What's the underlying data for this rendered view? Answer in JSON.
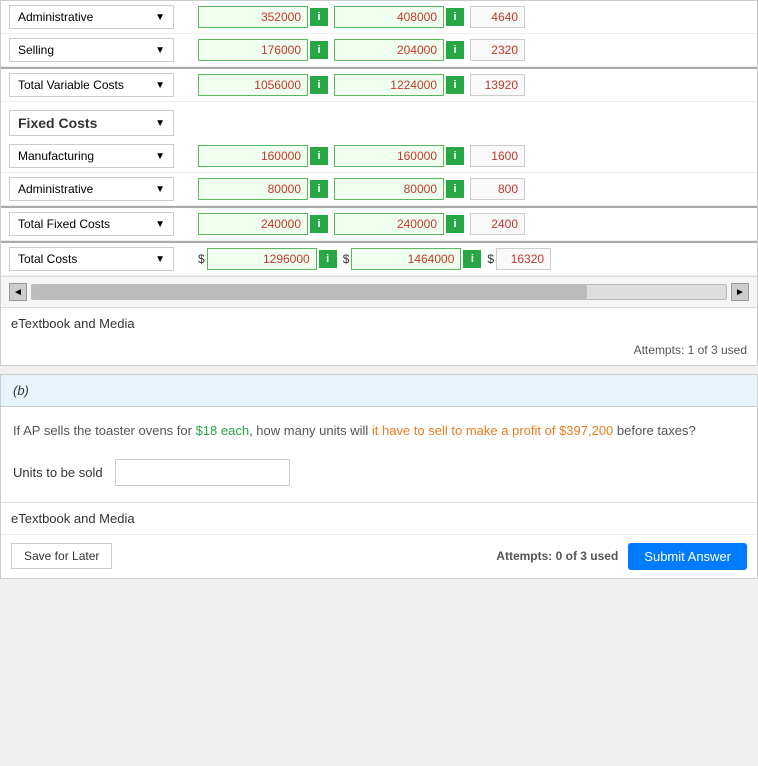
{
  "table": {
    "rows": [
      {
        "label": "Administrative",
        "type": "dropdown",
        "values": [
          "352000",
          "408000",
          "4640"
        ],
        "hasInfo": [
          true,
          true,
          false
        ]
      },
      {
        "label": "Selling",
        "type": "dropdown",
        "values": [
          "176000",
          "204000",
          "2320"
        ],
        "hasInfo": [
          true,
          true,
          false
        ]
      },
      {
        "label": "Total Variable Costs",
        "type": "dropdown-total",
        "values": [
          "1056000",
          "1224000",
          "13920"
        ],
        "hasInfo": [
          true,
          true,
          false
        ]
      }
    ],
    "fixed_costs_label": "Fixed Costs",
    "fixed_rows": [
      {
        "label": "Manufacturing",
        "type": "dropdown",
        "values": [
          "160000",
          "160000",
          "1600"
        ],
        "hasInfo": [
          true,
          true,
          false
        ]
      },
      {
        "label": "Administrative",
        "type": "dropdown",
        "values": [
          "80000",
          "80000",
          "800"
        ],
        "hasInfo": [
          true,
          true,
          false
        ]
      },
      {
        "label": "Total Fixed Costs",
        "type": "dropdown-total",
        "values": [
          "240000",
          "240000",
          "2400"
        ],
        "hasInfo": [
          true,
          true,
          false
        ]
      },
      {
        "label": "Total Costs",
        "type": "dropdown-total",
        "prefix": [
          "$",
          "$",
          "$"
        ],
        "values": [
          "1296000",
          "1464000",
          "16320"
        ],
        "hasInfo": [
          true,
          true,
          false
        ]
      }
    ],
    "info_label": "i",
    "etextbook": "eTextbook and Media",
    "attempts": "Attempts: 1 of 3 used"
  },
  "section_b": {
    "header": "(b)",
    "question": "If AP sells the toaster ovens for $18 each, how many units will it have to sell to make a profit of $397,200 before taxes?",
    "question_parts": {
      "before_price": "If AP sells the toaster ovens for ",
      "price": "$18 each",
      "after_price": ", how many units will ",
      "mid": "it have to sell to make a profit of ",
      "profit": "$397,200",
      "after_profit": " before taxes?"
    },
    "units_label": "Units to be sold",
    "units_placeholder": "",
    "etextbook": "eTextbook and Media",
    "save_later": "Save for Later",
    "attempts": "Attempts: 0 of 3 used",
    "submit": "Submit Answer"
  },
  "scrollbar": {
    "left_arrow": "◄",
    "right_arrow": "►"
  }
}
